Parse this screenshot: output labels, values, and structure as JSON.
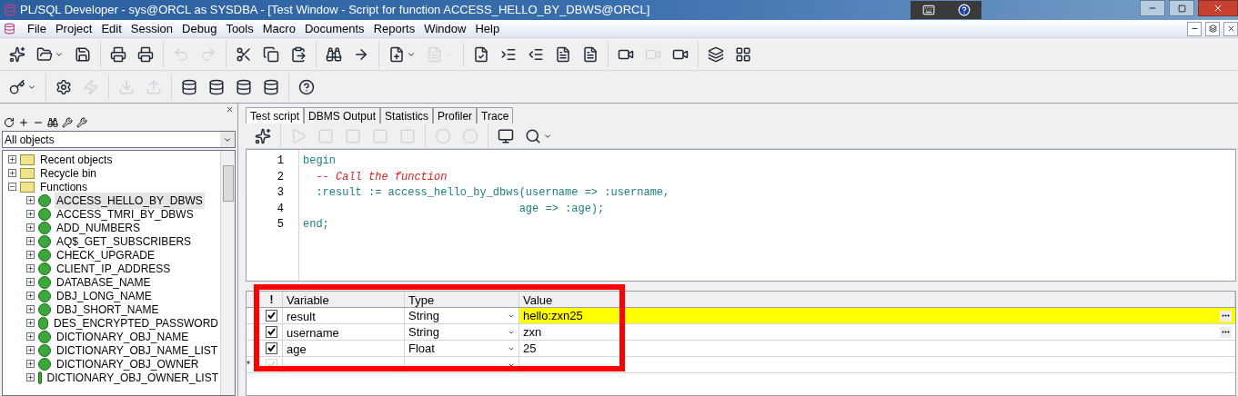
{
  "window": {
    "title": "PL/SQL Developer - sys@ORCL as SYSDBA - [Test Window - Script for function ACCESS_HELLO_BY_DBWS@ORCL]"
  },
  "menu": [
    "File",
    "Project",
    "Edit",
    "Session",
    "Debug",
    "Tools",
    "Macro",
    "Documents",
    "Reports",
    "Window",
    "Help"
  ],
  "browser": {
    "filter": "All objects",
    "tree": [
      {
        "label": "Recent objects",
        "kind": "folder",
        "expanded": false,
        "selected": false
      },
      {
        "label": "Recycle bin",
        "kind": "folder",
        "expanded": false,
        "selected": false
      },
      {
        "label": "Functions",
        "kind": "folder",
        "expanded": true,
        "selected": false,
        "children": [
          {
            "label": "ACCESS_HELLO_BY_DBWS",
            "kind": "function",
            "expanded": false,
            "selected": true
          },
          {
            "label": "ACCESS_TMRI_BY_DBWS",
            "kind": "function",
            "expanded": false,
            "selected": false
          },
          {
            "label": "ADD_NUMBERS",
            "kind": "function",
            "expanded": false,
            "selected": false
          },
          {
            "label": "AQ$_GET_SUBSCRIBERS",
            "kind": "function",
            "expanded": false,
            "selected": false
          },
          {
            "label": "CHECK_UPGRADE",
            "kind": "function",
            "expanded": false,
            "selected": false
          },
          {
            "label": "CLIENT_IP_ADDRESS",
            "kind": "function",
            "expanded": false,
            "selected": false
          },
          {
            "label": "DATABASE_NAME",
            "kind": "function",
            "expanded": false,
            "selected": false
          },
          {
            "label": "DBJ_LONG_NAME",
            "kind": "function",
            "expanded": false,
            "selected": false
          },
          {
            "label": "DBJ_SHORT_NAME",
            "kind": "function",
            "expanded": false,
            "selected": false
          },
          {
            "label": "DES_ENCRYPTED_PASSWORD",
            "kind": "function",
            "expanded": false,
            "selected": false
          },
          {
            "label": "DICTIONARY_OBJ_NAME",
            "kind": "function",
            "expanded": false,
            "selected": false
          },
          {
            "label": "DICTIONARY_OBJ_NAME_LIST",
            "kind": "function",
            "expanded": false,
            "selected": false
          },
          {
            "label": "DICTIONARY_OBJ_OWNER",
            "kind": "function",
            "expanded": false,
            "selected": false
          },
          {
            "label": "DICTIONARY_OBJ_OWNER_LIST",
            "kind": "function",
            "expanded": false,
            "selected": false
          }
        ]
      }
    ]
  },
  "tabs": [
    {
      "label": "Test script",
      "selected": true
    },
    {
      "label": "DBMS Output",
      "selected": false
    },
    {
      "label": "Statistics",
      "selected": false
    },
    {
      "label": "Profiler",
      "selected": false
    },
    {
      "label": "Trace",
      "selected": false
    }
  ],
  "editor": {
    "lines": [
      {
        "number": "1",
        "kind": "keyword",
        "text": "begin"
      },
      {
        "number": "2",
        "kind": "comment",
        "text": "  -- Call the function"
      },
      {
        "number": "3",
        "kind": "code",
        "text": "  :result := access_hello_by_dbws(username => :username,"
      },
      {
        "number": "4",
        "kind": "code",
        "text": "                                 age => :age);"
      },
      {
        "number": "5",
        "kind": "keyword",
        "text": "end;"
      }
    ]
  },
  "variables": {
    "marker": "!",
    "columns": [
      "Variable",
      "Type",
      "Value"
    ],
    "rows": [
      {
        "checked": true,
        "variable": "result",
        "type": "String",
        "value": "hello:zxn25",
        "highlighted": true,
        "new": false
      },
      {
        "checked": true,
        "variable": "username",
        "type": "String",
        "value": "zxn",
        "highlighted": false,
        "new": false
      },
      {
        "checked": true,
        "variable": "age",
        "type": "Float",
        "value": "25",
        "highlighted": false,
        "new": false
      },
      {
        "checked": true,
        "variable": "",
        "type": "",
        "value": "",
        "highlighted": false,
        "new": true,
        "row_marker": "*"
      }
    ],
    "annotation": true
  }
}
